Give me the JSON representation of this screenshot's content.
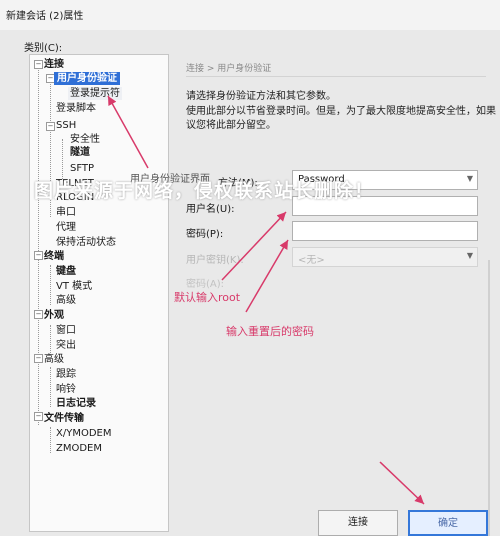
{
  "window": {
    "title": "新建会话 (2)属性"
  },
  "category_label": "类别(C):",
  "tree": [
    {
      "label": "连接",
      "bold": true
    },
    {
      "label": "用户身份验证",
      "bold": true,
      "selected": true
    },
    {
      "label": "登录提示符",
      "highlight": true
    },
    {
      "label": "登录脚本"
    },
    {
      "label": "SSH"
    },
    {
      "label": "安全性"
    },
    {
      "label": "隧道",
      "bold": true
    },
    {
      "label": "SFTP"
    },
    {
      "label": "TELNET"
    },
    {
      "label": "RLOGIN"
    },
    {
      "label": "串口"
    },
    {
      "label": "代理"
    },
    {
      "label": "保持活动状态"
    },
    {
      "label": "终端",
      "bold": true
    },
    {
      "label": "键盘",
      "bold": true
    },
    {
      "label": "VT 模式"
    },
    {
      "label": "高级"
    },
    {
      "label": "外观",
      "bold": true
    },
    {
      "label": "窗口"
    },
    {
      "label": "突出"
    },
    {
      "label": "高级"
    },
    {
      "label": "跟踪"
    },
    {
      "label": "响铃"
    },
    {
      "label": "日志记录",
      "bold": true
    },
    {
      "label": "文件传输",
      "bold": true
    },
    {
      "label": "X/YMODEM"
    },
    {
      "label": "ZMODEM"
    }
  ],
  "panel": {
    "breadcrumb": "连接 > 用户身份验证",
    "desc1": "请选择身份验证方法和其它参数。",
    "desc2": "使用此部分以节省登录时间。但是，为了最大限度地提高安全性，如果",
    "desc3": "议您将此部分留空。",
    "method_label": "方法(M):",
    "method_value": "Password",
    "overlay_label": "用户身份验证界面",
    "username_label": "用户名(U):",
    "username_value": "",
    "password_label": "密码(P):",
    "password_value": "",
    "key_label": "用户密钥(K):",
    "key_value": "<无>",
    "passphrase_label": "密码(A):"
  },
  "watermark": "图片来源于网络，侵权联系站长删除！",
  "annotations": {
    "default_root": "默认输入root",
    "reset_password": "输入重置后的密码"
  },
  "buttons": {
    "connect": "连接",
    "ok": "确定"
  },
  "colors": {
    "selection": "#2f6fd6",
    "annotation": "#d83a6a",
    "primary_border": "#3477d9"
  }
}
